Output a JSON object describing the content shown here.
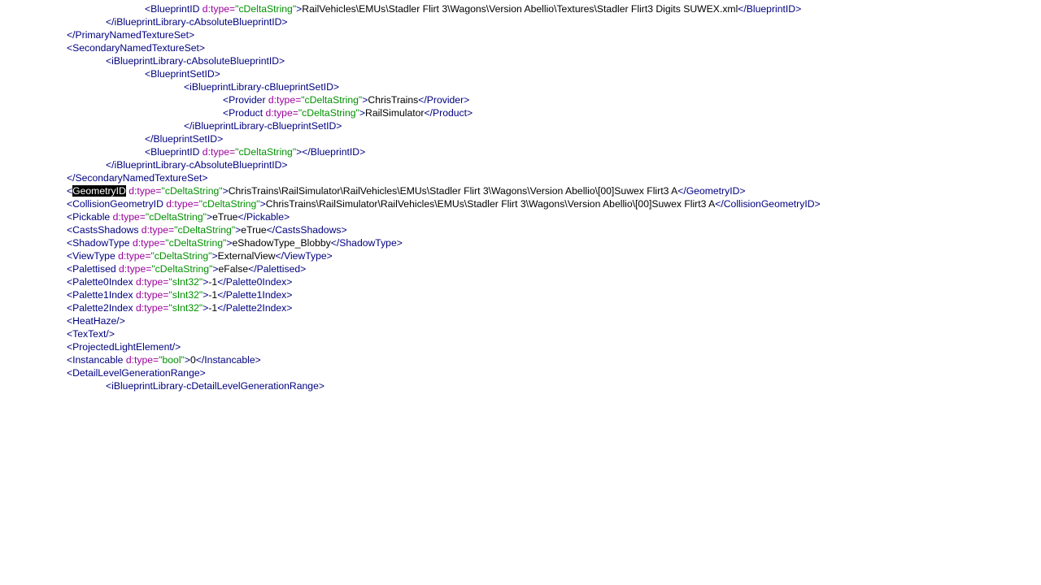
{
  "colors": {
    "markup": "#000080",
    "attribute": "#9b009b",
    "attribute_value": "#009000",
    "text": "#000000",
    "selection_bg": "#000000",
    "selection_fg": "#ffffff"
  },
  "lines": [
    {
      "name": "line-blueprintid-digits",
      "segs": [
        {
          "c": "b",
          "t": "<BlueprintID "
        },
        {
          "c": "a",
          "t": "d:type="
        },
        {
          "c": "s",
          "t": "\"cDeltaString\""
        },
        {
          "c": "b",
          "t": ">"
        },
        {
          "c": "t",
          "t": "RailVehicles\\EMUs\\Stadler Flirt 3\\Wagons\\Version Abellio\\Textures\\Stadler Flirt3 Digits SUWEX.xml"
        },
        {
          "c": "b",
          "t": "</BlueprintID>"
        }
      ]
    },
    {
      "name": "line-close-absolute-blueprintid",
      "segs": [
        {
          "c": "b",
          "t": "</iBlueprintLibrary-cAbsoluteBlueprintID>"
        }
      ]
    },
    {
      "name": "line-close-primary-texture-set",
      "segs": [
        {
          "c": "b",
          "t": "</PrimaryNamedTextureSet>"
        }
      ]
    },
    {
      "name": "line-open-secondary-texture-set",
      "segs": [
        {
          "c": "b",
          "t": "<SecondaryNamedTextureSet>"
        }
      ]
    },
    {
      "name": "line-open-absolute-blueprintid",
      "segs": [
        {
          "c": "b",
          "t": "<iBlueprintLibrary-cAbsoluteBlueprintID>"
        }
      ]
    },
    {
      "name": "line-open-blueprintsetid",
      "segs": [
        {
          "c": "b",
          "t": "<BlueprintSetID>"
        }
      ]
    },
    {
      "name": "line-open-cblueprintsetid",
      "segs": [
        {
          "c": "b",
          "t": "<iBlueprintLibrary-cBlueprintSetID>"
        }
      ]
    },
    {
      "name": "line-provider",
      "segs": [
        {
          "c": "b",
          "t": "<Provider "
        },
        {
          "c": "a",
          "t": "d:type="
        },
        {
          "c": "s",
          "t": "\"cDeltaString\""
        },
        {
          "c": "b",
          "t": ">"
        },
        {
          "c": "t",
          "t": "ChrisTrains"
        },
        {
          "c": "b",
          "t": "</Provider>"
        }
      ]
    },
    {
      "name": "line-product",
      "segs": [
        {
          "c": "b",
          "t": "<Product "
        },
        {
          "c": "a",
          "t": "d:type="
        },
        {
          "c": "s",
          "t": "\"cDeltaString\""
        },
        {
          "c": "b",
          "t": ">"
        },
        {
          "c": "t",
          "t": "RailSimulator"
        },
        {
          "c": "b",
          "t": "</Product>"
        }
      ]
    },
    {
      "name": "line-close-cblueprintsetid",
      "segs": [
        {
          "c": "b",
          "t": "</iBlueprintLibrary-cBlueprintSetID>"
        }
      ]
    },
    {
      "name": "line-close-blueprintsetid",
      "segs": [
        {
          "c": "b",
          "t": "</BlueprintSetID>"
        }
      ]
    },
    {
      "name": "line-blueprintid-empty",
      "segs": [
        {
          "c": "b",
          "t": "<BlueprintID "
        },
        {
          "c": "a",
          "t": "d:type="
        },
        {
          "c": "s",
          "t": "\"cDeltaString\""
        },
        {
          "c": "b",
          "t": "></BlueprintID>"
        }
      ]
    },
    {
      "name": "line-close-absolute-blueprintid-2",
      "segs": [
        {
          "c": "b",
          "t": "</iBlueprintLibrary-cAbsoluteBlueprintID>"
        }
      ]
    },
    {
      "name": "line-close-secondary-texture-set",
      "segs": [
        {
          "c": "b",
          "t": "</SecondaryNamedTextureSet>"
        }
      ]
    },
    {
      "name": "line-geometryid",
      "segs": [
        {
          "c": "b",
          "t": "<"
        },
        {
          "c": "sel",
          "t": "GeometryID"
        },
        {
          "c": "b",
          "t": " "
        },
        {
          "c": "a",
          "t": "d:type="
        },
        {
          "c": "s",
          "t": "\"cDeltaString\""
        },
        {
          "c": "b",
          "t": ">"
        },
        {
          "c": "t",
          "t": "ChrisTrains\\RailSimulator\\RailVehicles\\EMUs\\Stadler Flirt 3\\Wagons\\Version Abellio\\[00]Suwex Flirt3 A"
        },
        {
          "c": "b",
          "t": "</GeometryID>"
        }
      ]
    },
    {
      "name": "line-collisiongeometryid",
      "segs": [
        {
          "c": "b",
          "t": "<CollisionGeometryID "
        },
        {
          "c": "a",
          "t": "d:type="
        },
        {
          "c": "s",
          "t": "\"cDeltaString\""
        },
        {
          "c": "b",
          "t": ">"
        },
        {
          "c": "t",
          "t": "ChrisTrains\\RailSimulator\\RailVehicles\\EMUs\\Stadler Flirt 3\\Wagons\\Version Abellio\\[00]Suwex Flirt3 A"
        },
        {
          "c": "b",
          "t": "</CollisionGeometryID>"
        }
      ]
    },
    {
      "name": "line-pickable",
      "segs": [
        {
          "c": "b",
          "t": "<Pickable "
        },
        {
          "c": "a",
          "t": "d:type="
        },
        {
          "c": "s",
          "t": "\"cDeltaString\""
        },
        {
          "c": "b",
          "t": ">"
        },
        {
          "c": "t",
          "t": "eTrue"
        },
        {
          "c": "b",
          "t": "</Pickable>"
        }
      ]
    },
    {
      "name": "line-castsshadows",
      "segs": [
        {
          "c": "b",
          "t": "<CastsShadows "
        },
        {
          "c": "a",
          "t": "d:type="
        },
        {
          "c": "s",
          "t": "\"cDeltaString\""
        },
        {
          "c": "b",
          "t": ">"
        },
        {
          "c": "t",
          "t": "eTrue"
        },
        {
          "c": "b",
          "t": "</CastsShadows>"
        }
      ]
    },
    {
      "name": "line-shadowtype",
      "segs": [
        {
          "c": "b",
          "t": "<ShadowType "
        },
        {
          "c": "a",
          "t": "d:type="
        },
        {
          "c": "s",
          "t": "\"cDeltaString\""
        },
        {
          "c": "b",
          "t": ">"
        },
        {
          "c": "t",
          "t": "eShadowType_Blobby"
        },
        {
          "c": "b",
          "t": "</ShadowType>"
        }
      ]
    },
    {
      "name": "line-viewtype",
      "segs": [
        {
          "c": "b",
          "t": "<ViewType "
        },
        {
          "c": "a",
          "t": "d:type="
        },
        {
          "c": "s",
          "t": "\"cDeltaString\""
        },
        {
          "c": "b",
          "t": ">"
        },
        {
          "c": "t",
          "t": "ExternalView"
        },
        {
          "c": "b",
          "t": "</ViewType>"
        }
      ]
    },
    {
      "name": "line-palettised",
      "segs": [
        {
          "c": "b",
          "t": "<Palettised "
        },
        {
          "c": "a",
          "t": "d:type="
        },
        {
          "c": "s",
          "t": "\"cDeltaString\""
        },
        {
          "c": "b",
          "t": ">"
        },
        {
          "c": "t",
          "t": "eFalse"
        },
        {
          "c": "b",
          "t": "</Palettised>"
        }
      ]
    },
    {
      "name": "line-palette0index",
      "segs": [
        {
          "c": "b",
          "t": "<Palette0Index "
        },
        {
          "c": "a",
          "t": "d:type="
        },
        {
          "c": "s",
          "t": "\"sInt32\""
        },
        {
          "c": "b",
          "t": ">"
        },
        {
          "c": "t",
          "t": "-1"
        },
        {
          "c": "b",
          "t": "</Palette0Index>"
        }
      ]
    },
    {
      "name": "line-palette1index",
      "segs": [
        {
          "c": "b",
          "t": "<Palette1Index "
        },
        {
          "c": "a",
          "t": "d:type="
        },
        {
          "c": "s",
          "t": "\"sInt32\""
        },
        {
          "c": "b",
          "t": ">"
        },
        {
          "c": "t",
          "t": "-1"
        },
        {
          "c": "b",
          "t": "</Palette1Index>"
        }
      ]
    },
    {
      "name": "line-palette2index",
      "segs": [
        {
          "c": "b",
          "t": "<Palette2Index "
        },
        {
          "c": "a",
          "t": "d:type="
        },
        {
          "c": "s",
          "t": "\"sInt32\""
        },
        {
          "c": "b",
          "t": ">"
        },
        {
          "c": "t",
          "t": "-1"
        },
        {
          "c": "b",
          "t": "</Palette2Index>"
        }
      ]
    },
    {
      "name": "line-heathaze",
      "segs": [
        {
          "c": "b",
          "t": "<HeatHaze/>"
        }
      ]
    },
    {
      "name": "line-textext",
      "segs": [
        {
          "c": "b",
          "t": "<TexText/>"
        }
      ]
    },
    {
      "name": "line-projectedlightelement",
      "segs": [
        {
          "c": "b",
          "t": "<ProjectedLightElement/>"
        }
      ]
    },
    {
      "name": "line-instancable",
      "segs": [
        {
          "c": "b",
          "t": "<Instancable "
        },
        {
          "c": "a",
          "t": "d:type="
        },
        {
          "c": "s",
          "t": "\"bool\""
        },
        {
          "c": "b",
          "t": ">"
        },
        {
          "c": "t",
          "t": "0"
        },
        {
          "c": "b",
          "t": "</Instancable>"
        }
      ]
    },
    {
      "name": "line-detaillevelgenerationrange",
      "segs": [
        {
          "c": "b",
          "t": "<DetailLevelGenerationRange>"
        }
      ]
    },
    {
      "name": "line-partial-cut-off",
      "segs": [
        {
          "c": "b",
          "t": "<iBlueprintLibrary-cDetailLevelGenerationRange>"
        }
      ]
    }
  ]
}
